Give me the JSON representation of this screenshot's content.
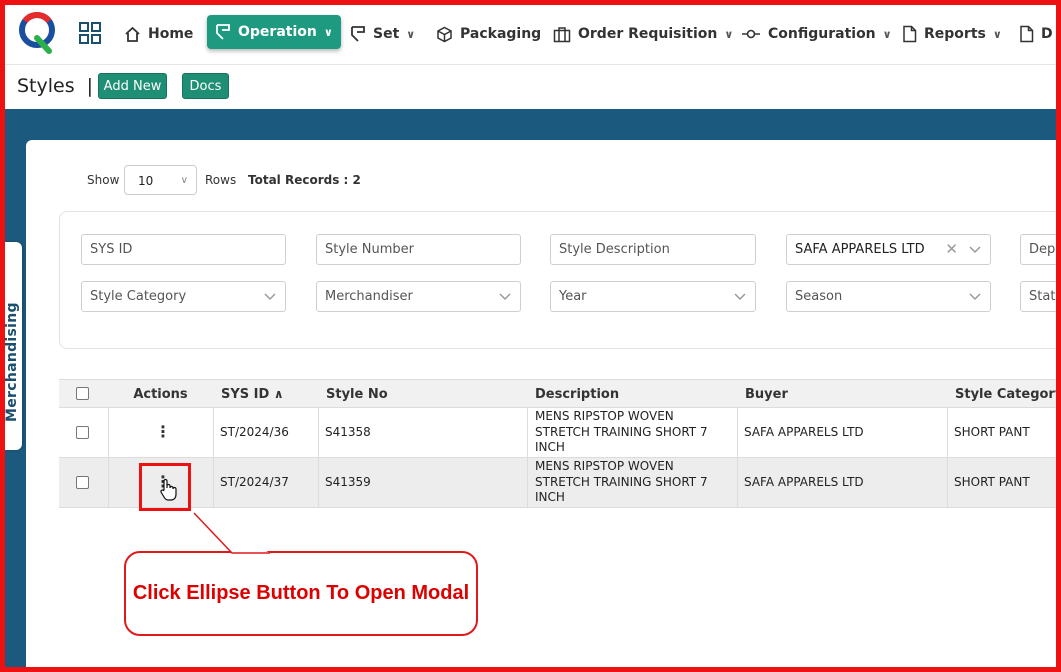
{
  "nav": {
    "items": [
      {
        "label": "Home",
        "icon": "home-icon"
      },
      {
        "label": "Operation",
        "icon": "operation-icon",
        "active": true
      },
      {
        "label": "Set",
        "icon": "set-icon"
      },
      {
        "label": "Packaging",
        "icon": "box-icon"
      },
      {
        "label": "Order Requisition",
        "icon": "briefcase-icon"
      },
      {
        "label": "Configuration",
        "icon": "commit-icon"
      },
      {
        "label": "Reports",
        "icon": "document-icon"
      },
      {
        "label": "D",
        "icon": "document-icon"
      }
    ],
    "accent": "#1e9a80"
  },
  "subheader": {
    "title": "Styles",
    "separator": "|",
    "add_new": "Add New",
    "docs": "Docs"
  },
  "side_tab": "Merchandising",
  "list_controls": {
    "show_label": "Show",
    "rows_value": "10",
    "rows_label": "Rows",
    "total_label": "Total Records : 2"
  },
  "filters": {
    "sys_id": "SYS ID",
    "style_number": "Style Number",
    "style_description": "Style Description",
    "buyer_value": "SAFA APPARELS LTD",
    "department": "Department",
    "style_category": "Style Category",
    "merchandiser": "Merchandiser",
    "year": "Year",
    "season": "Season",
    "status": "Status"
  },
  "table": {
    "headers": {
      "actions": "Actions",
      "sys_id": "SYS ID",
      "style_no": "Style No",
      "description": "Description",
      "buyer": "Buyer",
      "style_category": "Style Category"
    },
    "rows": [
      {
        "sys_id": "ST/2024/36",
        "style_no": "S41358",
        "description": "MENS RIPSTOP WOVEN STRETCH TRAINING SHORT 7 INCH",
        "buyer": "SAFA APPARELS LTD",
        "category": "SHORT PANT"
      },
      {
        "sys_id": "ST/2024/37",
        "style_no": "S41359",
        "description": "MENS RIPSTOP WOVEN STRETCH TRAINING SHORT 7 INCH",
        "buyer": "SAFA APPARELS LTD",
        "category": "SHORT PANT"
      }
    ]
  },
  "annotation": {
    "text": "Click Ellipse Button To Open Modal",
    "color": "#e01a1a"
  }
}
